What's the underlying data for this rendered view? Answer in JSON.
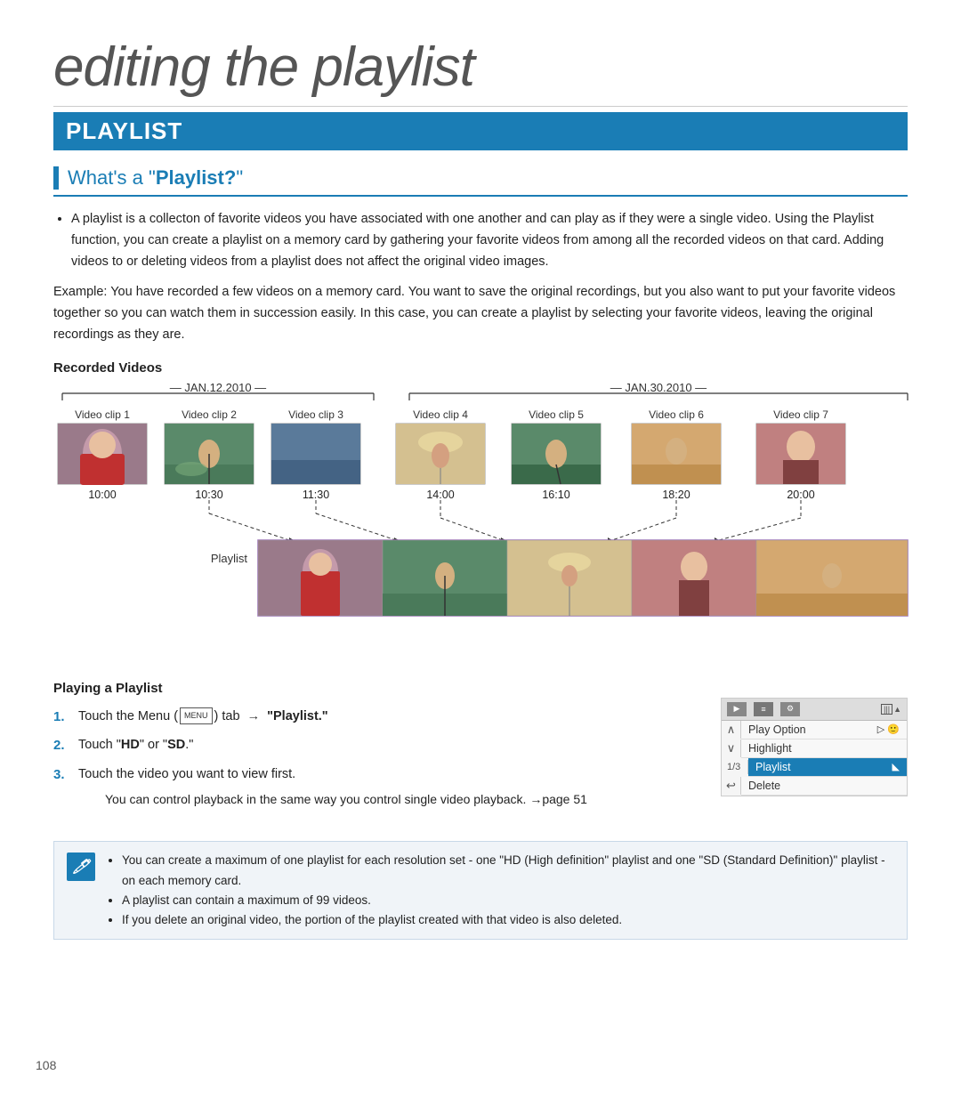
{
  "page": {
    "number": "108",
    "main_title": "editing the playlist",
    "section_title": "PLAYLIST",
    "what_is_title_pre": "What's a \"",
    "what_is_title_bold": "Playlist?",
    "what_is_title_post": "\"",
    "what_is_bullet": "A playlist is a collecton of favorite videos you have associated with one another and can play as if they were a single video. Using the Playlist function, you can create a playlist on a memory card by gathering your favorite videos from among all the recorded videos on that card. Adding videos to or deleting videos from a playlist does not affect the original video images.",
    "what_is_example": "Example: You have recorded a few videos on a memory card. You want to save the original recordings, but you also want to put your favorite videos together so you can watch them in succession easily. In this case, you can create a playlist by selecting your favorite videos, leaving the original recordings as they are.",
    "recorded_videos_label": "Recorded Videos",
    "dates": {
      "date1": "JAN.12.2010",
      "date2": "JAN.30.2010"
    },
    "clips": [
      {
        "label": "Video clip 1",
        "time": "10:00",
        "color": "clip-1"
      },
      {
        "label": "Video clip 2",
        "time": "10:30",
        "color": "clip-2"
      },
      {
        "label": "Video clip 3",
        "time": "11:30",
        "color": "clip-3"
      },
      {
        "label": "Video clip 4",
        "time": "14:00",
        "color": "clip-4"
      },
      {
        "label": "Video clip 5",
        "time": "16:10",
        "color": "clip-5"
      },
      {
        "label": "Video clip 6",
        "time": "18:20",
        "color": "clip-6"
      },
      {
        "label": "Video clip 7",
        "time": "20:00",
        "color": "clip-7"
      }
    ],
    "playlist_label": "Playlist",
    "playing_section": {
      "title": "Playing a Playlist",
      "steps": [
        {
          "num": "1.",
          "text_pre": "Touch the Menu (",
          "menu_icon": "MENU",
          "text_post": ") tab → \"Playlist.\""
        },
        {
          "num": "2.",
          "text": "Touch \"HD\" or \"SD.\""
        },
        {
          "num": "3.",
          "text": "Touch the video you want to view first.",
          "sub_bullet": "You can control playback in the same way you control single video playback. →page 51"
        }
      ],
      "menu_items": [
        {
          "label": "Play Option",
          "highlighted": false,
          "has_arrow": true
        },
        {
          "label": "Highlight",
          "highlighted": false,
          "has_arrow": false
        },
        {
          "label": "Playlist",
          "highlighted": true,
          "has_arrow": true
        },
        {
          "label": "Delete",
          "highlighted": false,
          "has_arrow": false
        }
      ],
      "page_indicator": "1/3"
    },
    "notes": [
      "You can create a maximum of one playlist for each resolution set - one \"HD (High definition\" playlist and one \"SD (Standard Definition)\" playlist - on each memory card.",
      "A playlist can contain a maximum of 99 videos.",
      "If you delete an original video, the portion of the playlist created with that video is also deleted."
    ]
  }
}
